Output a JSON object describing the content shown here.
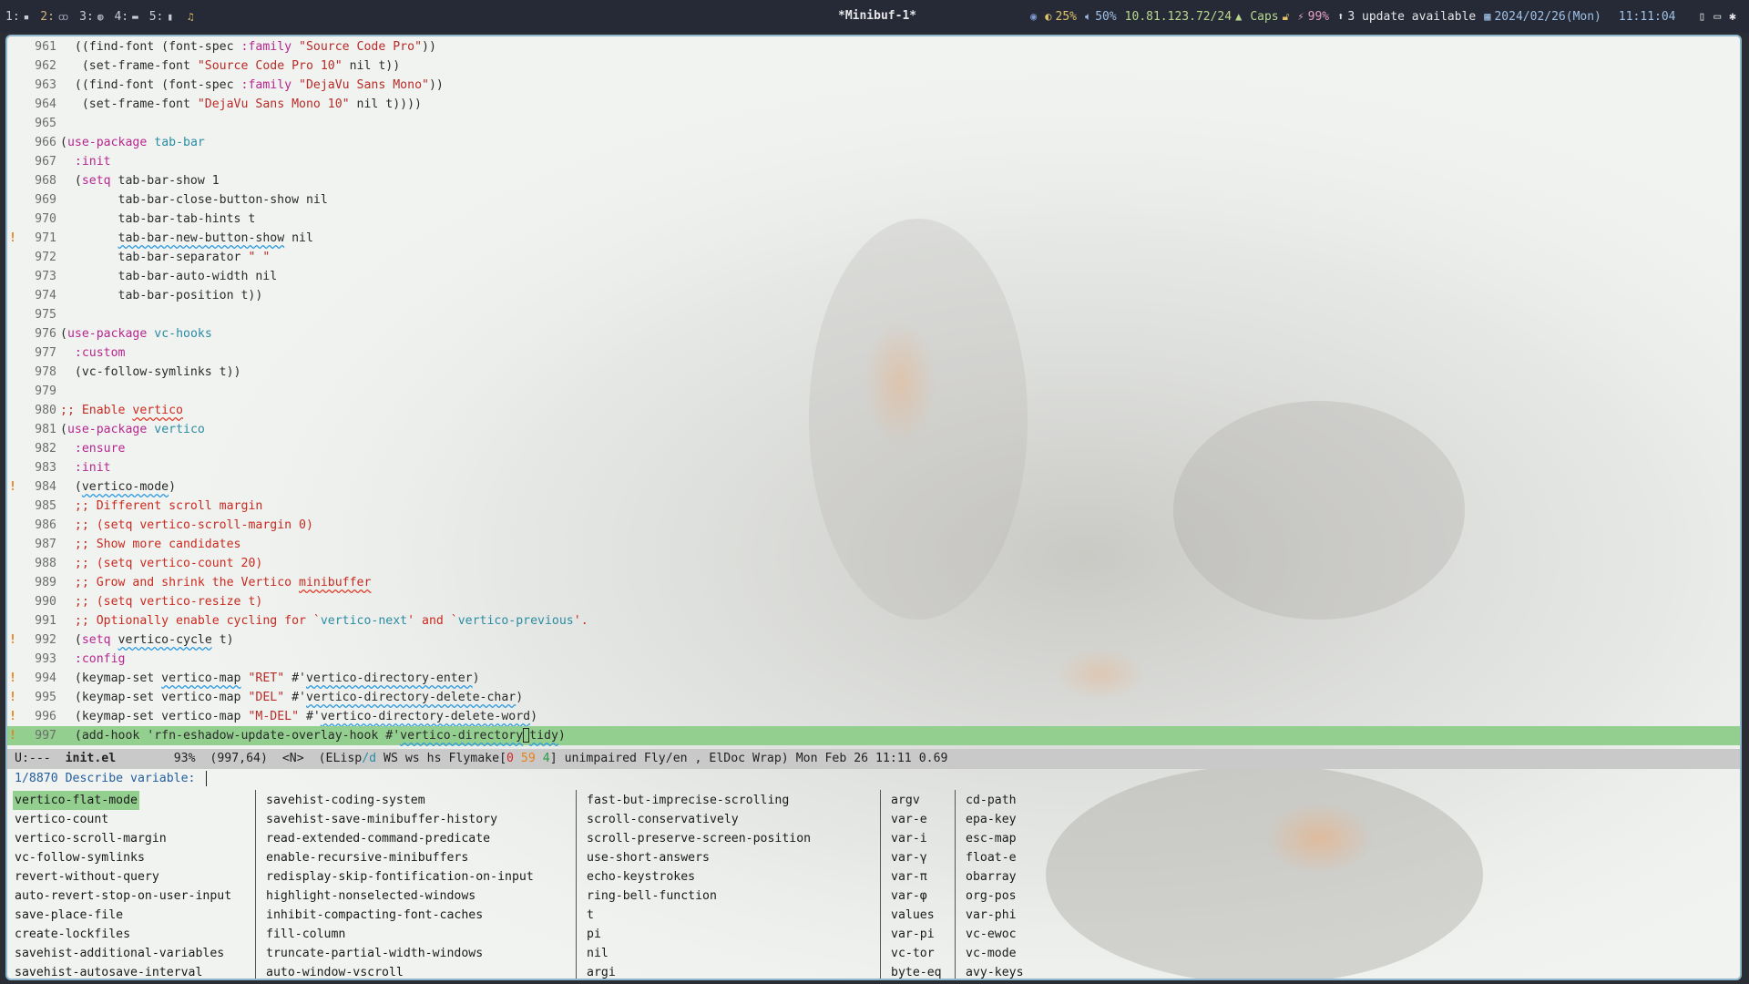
{
  "topbar": {
    "workspaces": [
      {
        "num": "1:",
        "icon": "terminal-icon",
        "active": false
      },
      {
        "num": "2:",
        "icon": "emacs-icon",
        "active": true
      },
      {
        "num": "3:",
        "icon": "browser-icon",
        "active": false
      },
      {
        "num": "4:",
        "icon": "chat-icon",
        "active": false
      },
      {
        "num": "5:",
        "icon": "file-icon",
        "active": false
      },
      {
        "num": "",
        "icon": "music-icon",
        "active": false
      }
    ],
    "window_title": "*Minibuf-1*",
    "status": {
      "brightness": "25%",
      "volume": "50%",
      "network": "10.81.123.72/24",
      "caps": "Caps",
      "battery": "99%",
      "updates": "3 update available",
      "date": "2024/02/26(Mon)",
      "time": "11:11:04"
    }
  },
  "editor": {
    "lines": [
      {
        "n": "961",
        "mark": "",
        "html": "  ((find-font (font-spec <span class=\"kw\">:family</span> <span class=\"str\">\"Source Code Pro\"</span>))"
      },
      {
        "n": "962",
        "mark": "",
        "html": "   (set-frame-font <span class=\"str\">\"Source Code Pro 10\"</span> nil t))"
      },
      {
        "n": "963",
        "mark": "",
        "html": "  ((find-font (font-spec <span class=\"kw\">:family</span> <span class=\"str\">\"DejaVu Sans Mono\"</span>))"
      },
      {
        "n": "964",
        "mark": "",
        "html": "   (set-frame-font <span class=\"str\">\"DejaVu Sans Mono 10\"</span> nil t))))"
      },
      {
        "n": "965",
        "mark": "",
        "html": ""
      },
      {
        "n": "966",
        "mark": "",
        "html": "(<span class=\"kw\">use-package</span> <span class=\"ty\">tab-bar</span>"
      },
      {
        "n": "967",
        "mark": "",
        "html": "  <span class=\"kw\">:init</span>"
      },
      {
        "n": "968",
        "mark": "",
        "html": "  (<span class=\"kw\">setq</span> tab-bar-show 1"
      },
      {
        "n": "969",
        "mark": "",
        "html": "        tab-bar-close-button-show nil"
      },
      {
        "n": "970",
        "mark": "",
        "html": "        tab-bar-tab-hints t"
      },
      {
        "n": "971",
        "mark": "!",
        "html": "        <span class=\"ul\">tab-bar-new-button-show</span> nil"
      },
      {
        "n": "972",
        "mark": "",
        "html": "        tab-bar-separator <span class=\"str\">\" \"</span>"
      },
      {
        "n": "973",
        "mark": "",
        "html": "        tab-bar-auto-width nil"
      },
      {
        "n": "974",
        "mark": "",
        "html": "        tab-bar-position t))"
      },
      {
        "n": "975",
        "mark": "",
        "html": ""
      },
      {
        "n": "976",
        "mark": "",
        "html": "(<span class=\"kw\">use-package</span> <span class=\"ty\">vc-hooks</span>"
      },
      {
        "n": "977",
        "mark": "",
        "html": "  <span class=\"kw\">:custom</span>"
      },
      {
        "n": "978",
        "mark": "",
        "html": "  (vc-follow-symlinks t))"
      },
      {
        "n": "979",
        "mark": "",
        "html": ""
      },
      {
        "n": "980",
        "mark": "",
        "html": "<span class=\"cm\">;; Enable <span class=\"ulr\">vertico</span></span>"
      },
      {
        "n": "981",
        "mark": "",
        "html": "(<span class=\"kw\">use-package</span> <span class=\"ty\">vertico</span>"
      },
      {
        "n": "982",
        "mark": "",
        "html": "  <span class=\"kw\">:ensure</span>"
      },
      {
        "n": "983",
        "mark": "",
        "html": "  <span class=\"kw\">:init</span>"
      },
      {
        "n": "984",
        "mark": "!",
        "html": "  (<span class=\"ul\">vertico-mode</span>)"
      },
      {
        "n": "985",
        "mark": "",
        "html": "  <span class=\"cm\">;; Different scroll margin</span>"
      },
      {
        "n": "986",
        "mark": "",
        "html": "  <span class=\"cm\">;; (setq vertico-scroll-margin 0)</span>"
      },
      {
        "n": "987",
        "mark": "",
        "html": "  <span class=\"cm\">;; Show more candidates</span>"
      },
      {
        "n": "988",
        "mark": "",
        "html": "  <span class=\"cm\">;; (setq vertico-count 20)</span>"
      },
      {
        "n": "989",
        "mark": "",
        "html": "  <span class=\"cm\">;; Grow and shrink the Vertico <span class=\"ulr\">minibuffer</span></span>"
      },
      {
        "n": "990",
        "mark": "",
        "html": "  <span class=\"cm\">;; (setq vertico-resize t)</span>"
      },
      {
        "n": "991",
        "mark": "",
        "html": "  <span class=\"cm\">;; Optionally enable cycling for `<span class=\"cm-ref\">vertico-next</span>' and `<span class=\"cm-ref\">vertico-previous</span>'.</span>"
      },
      {
        "n": "992",
        "mark": "!",
        "html": "  (<span class=\"kw\">setq</span> <span class=\"ul\">vertico-cycle</span> t)"
      },
      {
        "n": "993",
        "mark": "",
        "html": "  <span class=\"kw\">:config</span>"
      },
      {
        "n": "994",
        "mark": "!",
        "html": "  (keymap-set <span class=\"ul\">vertico-map</span> <span class=\"str\">\"RET\"</span> #'<span class=\"ul\">vertico-directory-enter</span>)"
      },
      {
        "n": "995",
        "mark": "!",
        "html": "  (keymap-set vertico-map <span class=\"str\">\"DEL\"</span> #'<span class=\"ul\">vertico-directory-delete-char</span>)"
      },
      {
        "n": "996",
        "mark": "!",
        "html": "  (keymap-set vertico-map <span class=\"str\">\"M-DEL\"</span> #'<span class=\"ul\">vertico-directory-delete-word</span>)"
      },
      {
        "n": "997",
        "mark": "!",
        "current": true,
        "html": "  (add-hook 'rfn-eshadow-update-overlay-hook #'<span class=\"ul\">vertico-directory</span><span class=\"cursor\"></span><span class=\"ul\">tidy</span>)"
      }
    ]
  },
  "modeline": {
    "state": "U:---",
    "buffer": "init.el",
    "percent": "93%",
    "position": "(997,64)",
    "evil": "<N>",
    "mode_open": "(ELisp",
    "mode_slash": "/d",
    "mode_mid": " WS ws hs Flymake[",
    "flymake_errors": "0",
    "flymake_warnings": "59",
    "flymake_notes": "4",
    "mode_tail": "] unimpaired Fly/en , ElDoc Wrap)",
    "datetime": "Mon Feb 26 11:11",
    "load": "0.69"
  },
  "minibuffer": {
    "prompt": "1/8870 Describe variable: ",
    "columns": [
      [
        "vertico-flat-mode",
        "vertico-count",
        "vertico-scroll-margin",
        "vc-follow-symlinks",
        "revert-without-query",
        "auto-revert-stop-on-user-input",
        "save-place-file",
        "create-lockfiles",
        "savehist-additional-variables",
        "savehist-autosave-interval"
      ],
      [
        "savehist-coding-system",
        "savehist-save-minibuffer-history",
        "read-extended-command-predicate",
        "enable-recursive-minibuffers",
        "redisplay-skip-fontification-on-input",
        "highlight-nonselected-windows",
        "inhibit-compacting-font-caches",
        "fill-column",
        "truncate-partial-width-windows",
        "auto-window-vscroll"
      ],
      [
        "fast-but-imprecise-scrolling",
        "scroll-conservatively",
        "scroll-preserve-screen-position",
        "use-short-answers",
        "echo-keystrokes",
        "ring-bell-function",
        "t",
        "pi",
        "nil",
        "argi"
      ],
      [
        "argv",
        "var-e",
        "var-i",
        "var-γ",
        "var-π",
        "var-φ",
        "values",
        "var-pi",
        "vc-tor",
        "byte-eq"
      ],
      [
        "cd-path",
        "epa-key",
        "esc-map",
        "float-e",
        "obarray",
        "org-pos",
        "var-phi",
        "vc-ewoc",
        "vc-mode",
        "avy-keys"
      ]
    ]
  }
}
